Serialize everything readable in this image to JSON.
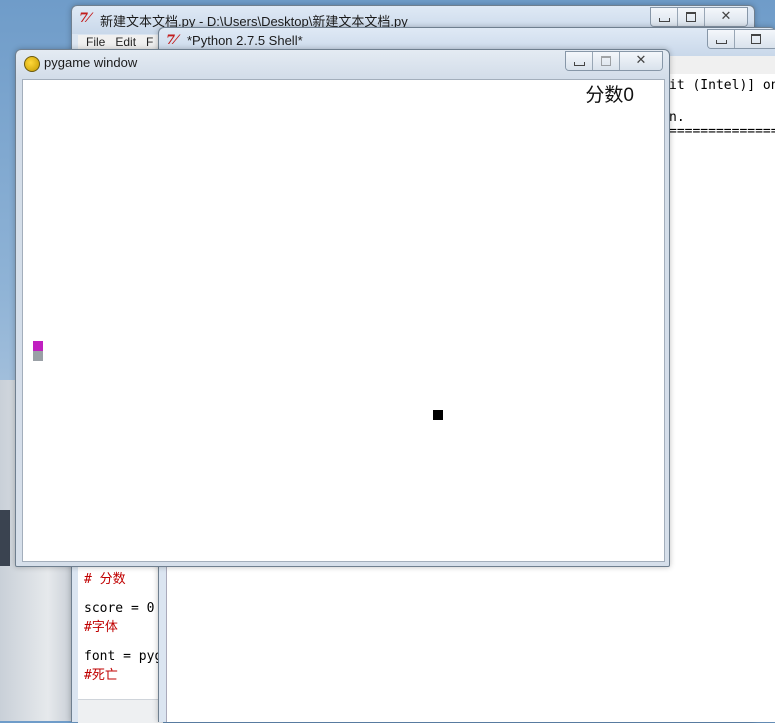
{
  "editor": {
    "title": "新建文本文档.py - D:\\Users\\Desktop\\新建文本文档.py",
    "menu": [
      "File",
      "Edit",
      "F"
    ],
    "code_lines": [
      {
        "text": "# 分数",
        "kind": "comment"
      },
      {
        "text": "",
        "kind": "text"
      },
      {
        "text": "score = 0",
        "kind": "text"
      },
      {
        "text": "#字体",
        "kind": "comment"
      },
      {
        "text": "",
        "kind": "text"
      },
      {
        "text": "font = pyg",
        "kind": "text"
      },
      {
        "text": "#死亡",
        "kind": "comment"
      }
    ]
  },
  "shell": {
    "title": "*Python 2.7.5 Shell*",
    "lines": [
      "it (Intel)] on",
      "",
      "n.",
      "================="
    ]
  },
  "pygame": {
    "title": "pygame window",
    "score_label": "分数0",
    "snake_colors": [
      "#c020c0",
      "#9aa0a6"
    ],
    "food_color": "#000000"
  },
  "title_icon_glyph": "7⁄"
}
